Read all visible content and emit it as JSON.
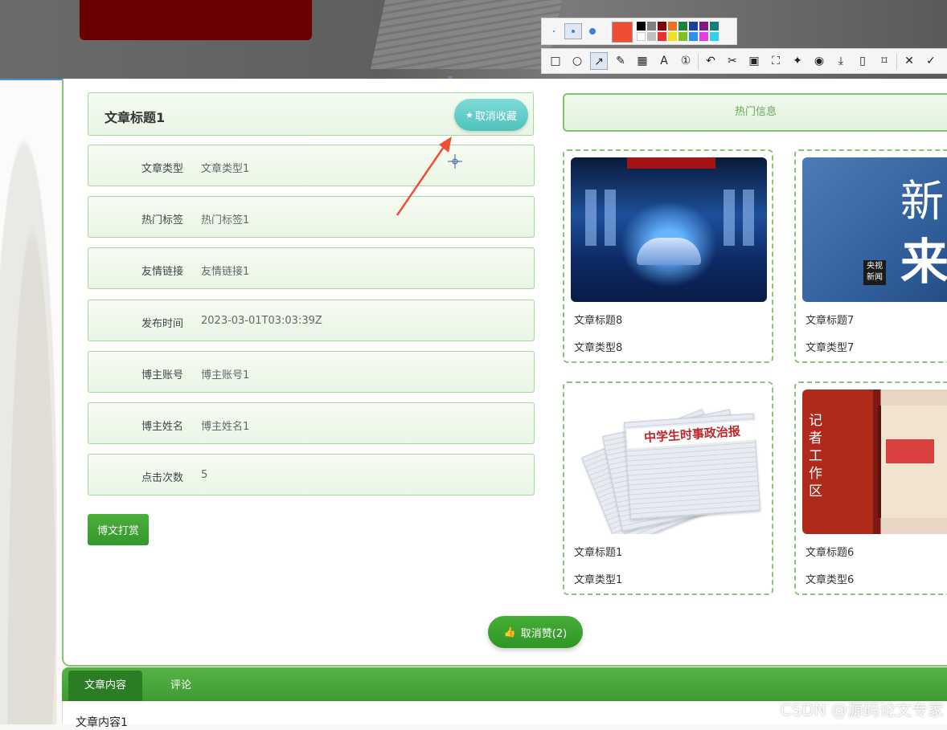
{
  "detail": {
    "title": "文章标题1",
    "fav_button": "取消收藏",
    "rows": [
      {
        "label": "文章类型",
        "value": "文章类型1"
      },
      {
        "label": "热门标签",
        "value": "热门标签1"
      },
      {
        "label": "友情链接",
        "value": "友情链接1"
      },
      {
        "label": "发布时间",
        "value": "2023-03-01T03:03:39Z"
      },
      {
        "label": "博主账号",
        "value": "博主账号1"
      },
      {
        "label": "博主姓名",
        "value": "博主姓名1"
      },
      {
        "label": "点击次数",
        "value": "5"
      }
    ],
    "reward_button": "博文打赏"
  },
  "hot": {
    "header": "热门信息",
    "cards": [
      {
        "title": "文章标题8",
        "type": "文章类型8"
      },
      {
        "title": "文章标题7",
        "type": "文章类型7",
        "image_text_1": "新",
        "image_text_2": "来",
        "image_logo": "央视新闻"
      },
      {
        "title": "文章标题1",
        "type": "文章类型1",
        "image_text": "中学生时事政治报"
      },
      {
        "title": "文章标题6",
        "type": "文章类型6",
        "image_text": "记者工作区"
      }
    ]
  },
  "like_button": "取消赞(2)",
  "tabs": [
    {
      "label": "文章内容"
    },
    {
      "label": "评论"
    }
  ],
  "content": "文章内容1",
  "watermark": "CSDN @源码论文专家",
  "colors": {
    "accent_green": "#3e9b32",
    "teal": "#4ec2bd",
    "annotation_red": "#f04d35"
  }
}
